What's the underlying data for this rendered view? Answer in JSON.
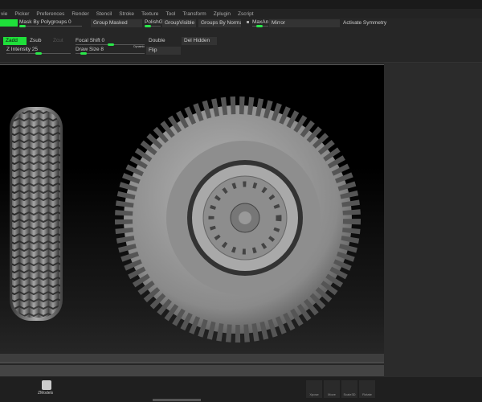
{
  "menu": [
    "vie",
    "Picker",
    "Preferences",
    "Render",
    "Stencil",
    "Stroke",
    "Texture",
    "Tool",
    "Transform",
    "Zplugin",
    "Zscript"
  ],
  "toolbar": {
    "mask_by_polygroups": "Mask By Polygroups 0",
    "group_masked": "Group Masked",
    "polishg": "PolishG",
    "group_visible": "GroupVisible",
    "groups_by_normals": "Groups By Normals",
    "maxang": "MaxAn",
    "mirror": "Mirror",
    "activate_symmetry": "Activate Symmetry",
    "zadd": "Zadd",
    "zsub": "Zsub",
    "zcut": "Zcut",
    "focal_shift": "Focal Shift 0",
    "draw_size": "Draw Size 8",
    "dynamic": "Dynamic",
    "z_intensity": "Z Intensity 25",
    "double": "Double",
    "flip": "Flip",
    "del_hidden": "Del Hidden"
  },
  "sliders": {
    "mask_by_polygroups": 0,
    "focal_shift": 0,
    "draw_size": 8,
    "z_intensity": 25
  },
  "bottom": {
    "zmodels": "ZModels",
    "xpose": "Xpose",
    "move": "Move",
    "scale": "Scale3D",
    "rotate": "Rotate"
  },
  "colors": {
    "accent": "#1fe03a"
  }
}
